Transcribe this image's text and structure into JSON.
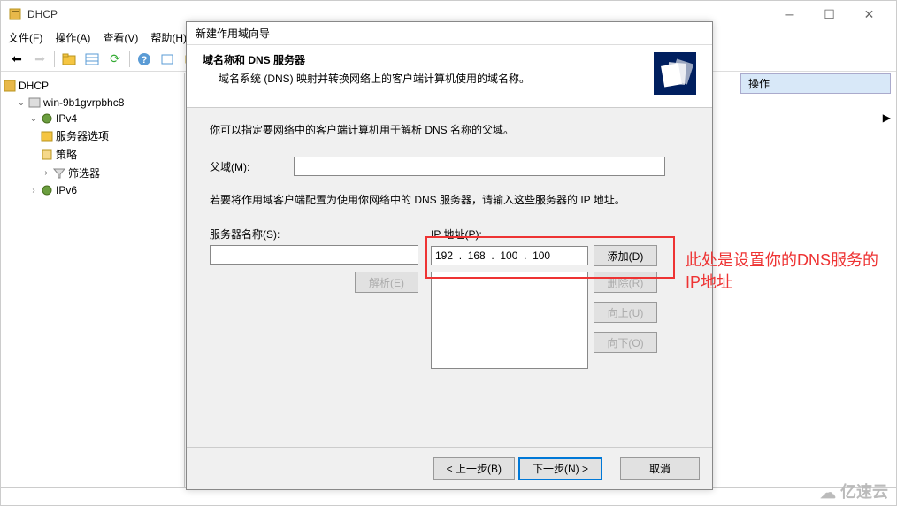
{
  "main_window": {
    "title": "DHCP",
    "menubar": [
      "文件(F)",
      "操作(A)",
      "查看(V)",
      "帮助(H)"
    ]
  },
  "tree": {
    "root": "DHCP",
    "nodes": [
      {
        "label": "win-9b1gvrpbhc8",
        "expanded": true
      },
      {
        "label": "IPv4",
        "expanded": true
      },
      {
        "label": "服务器选项"
      },
      {
        "label": "策略"
      },
      {
        "label": "筛选器"
      },
      {
        "label": "IPv6"
      }
    ]
  },
  "actions_panel": {
    "header": "操作"
  },
  "wizard": {
    "title": "新建作用域向导",
    "header_title": "域名称和 DNS 服务器",
    "header_sub": "域名系统 (DNS) 映射并转换网络上的客户端计算机使用的域名称。",
    "body_intro": "你可以指定要网络中的客户端计算机用于解析 DNS 名称的父域。",
    "parent_label": "父域(M):",
    "parent_value": "",
    "body_dns_text": "若要将作用域客户端配置为使用你网络中的 DNS 服务器，请输入这些服务器的 IP 地址。",
    "server_name_label": "服务器名称(S):",
    "server_name_value": "",
    "ip_label": "IP 地址(P):",
    "ip_value": "192  .  168  .  100  .  100",
    "resolve_btn": "解析(E)",
    "add_btn": "添加(D)",
    "remove_btn": "删除(R)",
    "up_btn": "向上(U)",
    "down_btn": "向下(O)",
    "back_btn": "< 上一步(B)",
    "next_btn": "下一步(N) >",
    "cancel_btn": "取消"
  },
  "annotation": "此处是设置你的DNS服务的IP地址",
  "watermark": "亿速云"
}
